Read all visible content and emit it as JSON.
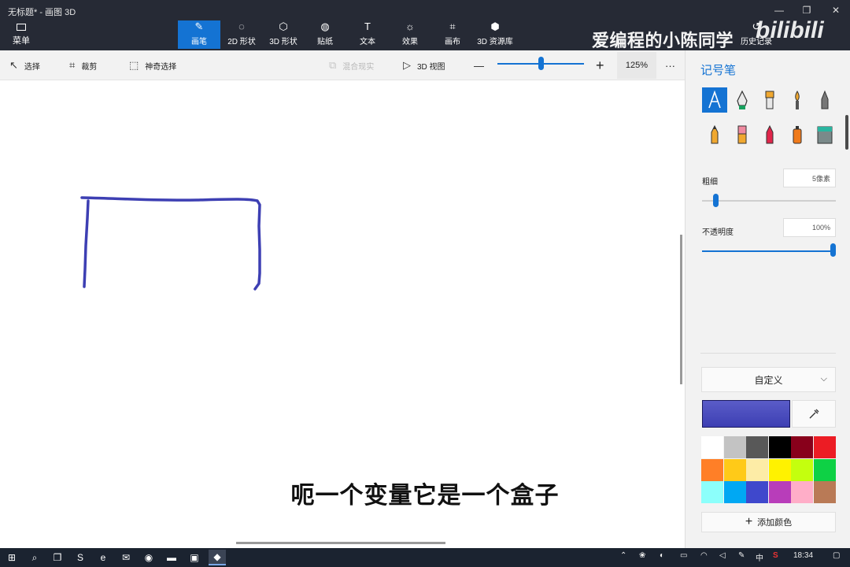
{
  "window": {
    "title": "无标题* - 画图 3D",
    "minimize": "—",
    "maximize": "❐",
    "close": "✕"
  },
  "ribbon": {
    "menu_label": "菜单",
    "tools": [
      {
        "label": "画笔",
        "icon": "brush-icon",
        "glyph": "✎",
        "active": true
      },
      {
        "label": "2D 形状",
        "icon": "2d-shapes-icon",
        "glyph": "◌"
      },
      {
        "label": "3D 形状",
        "icon": "3d-shapes-icon",
        "glyph": "⬡"
      },
      {
        "label": "贴纸",
        "icon": "sticker-icon",
        "glyph": "◍"
      },
      {
        "label": "文本",
        "icon": "text-icon",
        "glyph": "T"
      },
      {
        "label": "效果",
        "icon": "effects-icon",
        "glyph": "☼"
      },
      {
        "label": "画布",
        "icon": "canvas-icon",
        "glyph": "⌗"
      },
      {
        "label": "3D 资源库",
        "icon": "3d-library-icon",
        "glyph": "⬢"
      }
    ],
    "history_label": "历史记录"
  },
  "watermark": {
    "text": "爱编程的小陈同学",
    "logo": "bilibili"
  },
  "toolbar": {
    "select": "选择",
    "crop": "裁剪",
    "magic_select": "神奇选择",
    "mixed_reality": "混合现实",
    "view_3d": "3D 视图",
    "zoom_out": "—",
    "zoom_in": "+",
    "zoom_percent": 125,
    "zoom_label": "125%",
    "more": "···"
  },
  "panel": {
    "title": "记号笔",
    "brushes": [
      {
        "name": "marker",
        "selected": true
      },
      {
        "name": "calligraphy-pen"
      },
      {
        "name": "oil-brush"
      },
      {
        "name": "watercolor"
      },
      {
        "name": "pixel-pen"
      },
      {
        "name": "pencil"
      },
      {
        "name": "eraser"
      },
      {
        "name": "crayon"
      },
      {
        "name": "spray-can"
      },
      {
        "name": "fill"
      }
    ],
    "thickness_label": "粗细",
    "thickness_value": "5像素",
    "thickness_px": 5,
    "opacity_label": "不透明度",
    "opacity_value": "100%",
    "opacity_percent": 100,
    "color_mode": "自定义",
    "current_color": "#3d3fb3",
    "palette": [
      "#ffffff",
      "#c3c3c3",
      "#585858",
      "#000000",
      "#88001b",
      "#ec1c24",
      "#ff7f27",
      "#ffca18",
      "#fdeca6",
      "#fff200",
      "#c4ff0e",
      "#0ed145",
      "#8cfffb",
      "#00a8f3",
      "#3f48cc",
      "#b83dba",
      "#ffaec8",
      "#b97a56"
    ],
    "add_color": "添加颜色"
  },
  "canvas": {
    "subtitle": "呃一个变量它是一个盒子",
    "stroke_color": "#3d3fb3"
  },
  "taskbar": {
    "clock": "18:34",
    "ime": "中",
    "apps": [
      {
        "name": "start-icon",
        "glyph": "⊞"
      },
      {
        "name": "search-icon",
        "glyph": "⌕"
      },
      {
        "name": "task-view-icon",
        "glyph": "❐"
      },
      {
        "name": "sogou-icon",
        "glyph": "S"
      },
      {
        "name": "edge-icon",
        "glyph": "e"
      },
      {
        "name": "wechat-icon",
        "glyph": "✉"
      },
      {
        "name": "chrome-icon",
        "glyph": "◉"
      },
      {
        "name": "file-explorer-icon",
        "glyph": "▬"
      },
      {
        "name": "screen-recorder-icon",
        "glyph": "▣"
      },
      {
        "name": "paint-3d-icon",
        "glyph": "◆",
        "active": true
      }
    ]
  }
}
